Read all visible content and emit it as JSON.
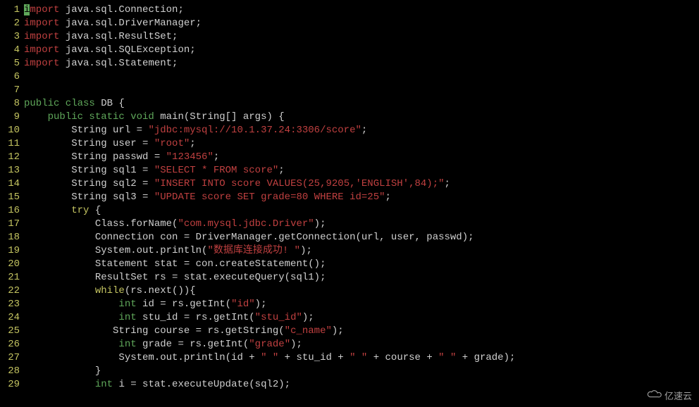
{
  "watermark": "亿速云",
  "lines": [
    {
      "n": 1,
      "tokens": [
        [
          "cursor",
          "i"
        ],
        [
          "kw-import",
          "mport"
        ],
        [
          "",
          " java.sql.Connection;"
        ]
      ]
    },
    {
      "n": 2,
      "tokens": [
        [
          "kw-import",
          "import"
        ],
        [
          "",
          " java.sql.DriverManager;"
        ]
      ]
    },
    {
      "n": 3,
      "tokens": [
        [
          "kw-import",
          "import"
        ],
        [
          "",
          " java.sql.ResultSet;"
        ]
      ]
    },
    {
      "n": 4,
      "tokens": [
        [
          "kw-import",
          "import"
        ],
        [
          "",
          " java.sql.SQLException;"
        ]
      ]
    },
    {
      "n": 5,
      "tokens": [
        [
          "kw-import",
          "import"
        ],
        [
          "",
          " java.sql.Statement;"
        ]
      ]
    },
    {
      "n": 6,
      "tokens": [
        [
          "",
          ""
        ]
      ]
    },
    {
      "n": 7,
      "tokens": [
        [
          "",
          ""
        ]
      ]
    },
    {
      "n": 8,
      "tokens": [
        [
          "kw-mod",
          "public class"
        ],
        [
          "",
          " DB {"
        ]
      ]
    },
    {
      "n": 9,
      "tokens": [
        [
          "",
          "    "
        ],
        [
          "kw-mod",
          "public static void"
        ],
        [
          "",
          " main(String[] args) {"
        ]
      ]
    },
    {
      "n": 10,
      "tokens": [
        [
          "",
          "        String url = "
        ],
        [
          "str",
          "\"jdbc:mysql://10.1.37.24:3306/score\""
        ],
        [
          "",
          ";"
        ]
      ]
    },
    {
      "n": 11,
      "tokens": [
        [
          "",
          "        String user = "
        ],
        [
          "str",
          "\"root\""
        ],
        [
          "",
          ";"
        ]
      ]
    },
    {
      "n": 12,
      "tokens": [
        [
          "",
          "        String passwd = "
        ],
        [
          "str",
          "\"123456\""
        ],
        [
          "",
          ";"
        ]
      ]
    },
    {
      "n": 13,
      "tokens": [
        [
          "",
          "        String sql1 = "
        ],
        [
          "str",
          "\"SELECT * FROM score\""
        ],
        [
          "",
          ";"
        ]
      ]
    },
    {
      "n": 14,
      "tokens": [
        [
          "",
          "        String sql2 = "
        ],
        [
          "str",
          "\"INSERT INTO score VALUES(25,9205,'ENGLISH',84);\""
        ],
        [
          "",
          ";"
        ]
      ]
    },
    {
      "n": 15,
      "tokens": [
        [
          "",
          "        String sql3 = "
        ],
        [
          "str",
          "\"UPDATE score SET grade=80 WHERE id=25\""
        ],
        [
          "",
          ";"
        ]
      ]
    },
    {
      "n": 16,
      "tokens": [
        [
          "",
          "        "
        ],
        [
          "kw-ctrl",
          "try"
        ],
        [
          "",
          " {"
        ]
      ]
    },
    {
      "n": 17,
      "tokens": [
        [
          "",
          "            Class.forName("
        ],
        [
          "str",
          "\"com.mysql.jdbc.Driver\""
        ],
        [
          "",
          ");"
        ]
      ]
    },
    {
      "n": 18,
      "tokens": [
        [
          "",
          "            Connection con = DriverManager.getConnection(url, user, passwd);"
        ]
      ]
    },
    {
      "n": 19,
      "tokens": [
        [
          "",
          "            System.out.println("
        ],
        [
          "str",
          "\"数据库连接成功! \""
        ],
        [
          "",
          ");"
        ]
      ]
    },
    {
      "n": 20,
      "tokens": [
        [
          "",
          "            Statement stat = con.createStatement();"
        ]
      ]
    },
    {
      "n": 21,
      "tokens": [
        [
          "",
          "            ResultSet rs = stat.executeQuery(sql1);"
        ]
      ]
    },
    {
      "n": 22,
      "tokens": [
        [
          "",
          "            "
        ],
        [
          "kw-ctrl",
          "while"
        ],
        [
          "",
          "(rs.next()){"
        ]
      ]
    },
    {
      "n": 23,
      "tokens": [
        [
          "",
          "                "
        ],
        [
          "kw-type",
          "int"
        ],
        [
          "",
          " id = rs.getInt("
        ],
        [
          "str",
          "\"id\""
        ],
        [
          "",
          ");"
        ]
      ]
    },
    {
      "n": 24,
      "tokens": [
        [
          "",
          "                "
        ],
        [
          "kw-type",
          "int"
        ],
        [
          "",
          " stu_id = rs.getInt("
        ],
        [
          "str",
          "\"stu_id\""
        ],
        [
          "",
          ");"
        ]
      ]
    },
    {
      "n": 25,
      "tokens": [
        [
          "",
          "               String course = rs.getString("
        ],
        [
          "str",
          "\"c_name\""
        ],
        [
          "",
          ");"
        ]
      ]
    },
    {
      "n": 26,
      "tokens": [
        [
          "",
          "                "
        ],
        [
          "kw-type",
          "int"
        ],
        [
          "",
          " grade = rs.getInt("
        ],
        [
          "str",
          "\"grade\""
        ],
        [
          "",
          ");"
        ]
      ]
    },
    {
      "n": 27,
      "tokens": [
        [
          "",
          "                System.out.println(id + "
        ],
        [
          "str",
          "\" \""
        ],
        [
          "",
          " + stu_id + "
        ],
        [
          "str",
          "\" \""
        ],
        [
          "",
          " + course + "
        ],
        [
          "str",
          "\" \""
        ],
        [
          "",
          " + grade);"
        ]
      ]
    },
    {
      "n": 28,
      "tokens": [
        [
          "",
          "            }"
        ]
      ]
    },
    {
      "n": 29,
      "tokens": [
        [
          "",
          "            "
        ],
        [
          "kw-type",
          "int"
        ],
        [
          "",
          " i = stat.executeUpdate(sql2);"
        ]
      ]
    }
  ]
}
